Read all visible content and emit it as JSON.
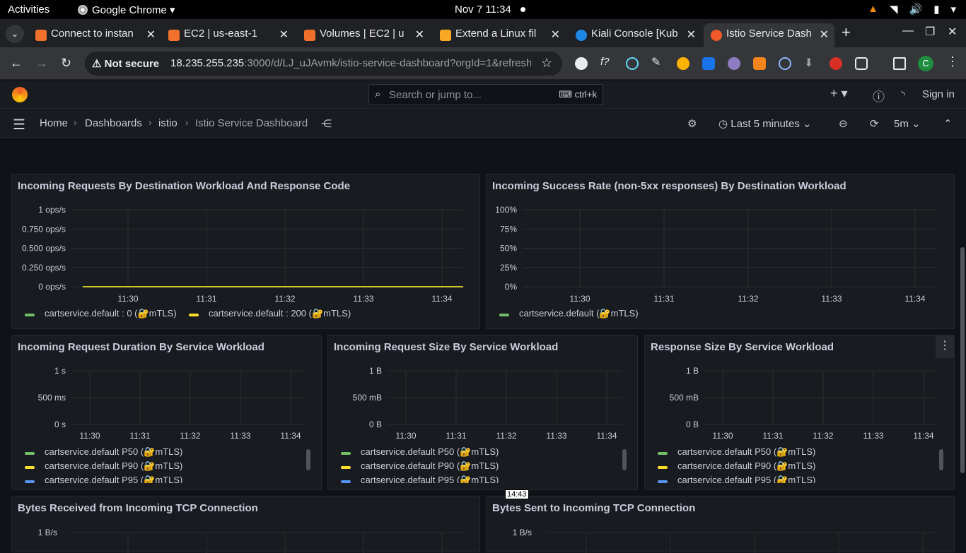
{
  "os": {
    "activities": "Activities",
    "app": "Google Chrome",
    "clock": "Nov 7  11:34"
  },
  "tabs": [
    {
      "title": "Connect to instan",
      "color": "#f0712c"
    },
    {
      "title": "EC2 | us-east-1",
      "color": "#f0712c"
    },
    {
      "title": "Volumes | EC2 | u",
      "color": "#f0712c"
    },
    {
      "title": "Extend a Linux fil",
      "color": "#f9a825"
    },
    {
      "title": "Kiali Console [Kub",
      "color": "#1e88e5"
    },
    {
      "title": "Istio Service Dash",
      "color": "#f05a28"
    }
  ],
  "toolbar": {
    "not_secure": "Not secure",
    "url_host": "18.235.255.235",
    "url_rest": ":3000/d/LJ_uJAvmk/istio-service-dashboard?orgId=1&refresh=5m",
    "profile": "C"
  },
  "grafana": {
    "search_placeholder": "Search or jump to...",
    "search_shortcut": "ctrl+k",
    "sign_in": "Sign in",
    "breadcrumbs": [
      "Home",
      "Dashboards",
      "istio",
      "Istio Service Dashboard"
    ],
    "time_range": "Last 5 minutes",
    "refresh": "5m"
  },
  "panels": {
    "p1": {
      "title": "Incoming Requests By Destination Workload And Response Code",
      "legend": [
        "cartservice.default : 0 (🔐mTLS)",
        "cartservice.default : 200 (🔐mTLS)"
      ]
    },
    "p2": {
      "title": "Incoming Success Rate (non-5xx responses) By Destination Workload",
      "legend": [
        "cartservice.default (🔐mTLS)"
      ]
    },
    "p3": {
      "title": "Incoming Request Duration By Service Workload",
      "legend": [
        "cartservice.default P50 (🔐mTLS)",
        "cartservice.default P90 (🔐mTLS)",
        "cartservice.default P95 (🔐mTLS)"
      ]
    },
    "p4": {
      "title": "Incoming Request Size By Service Workload",
      "legend": [
        "cartservice.default P50 (🔐mTLS)",
        "cartservice.default P90 (🔐mTLS)",
        "cartservice.default P95 (🔐mTLS)"
      ]
    },
    "p5": {
      "title": "Response Size By Service Workload",
      "legend": [
        "cartservice.default P50 (🔐mTLS)",
        "cartservice.default P90 (🔐mTLS)",
        "cartservice.default P95 (🔐mTLS)"
      ]
    },
    "p6": {
      "title": "Bytes Received from Incoming TCP Connection",
      "ytick": "1 B/s"
    },
    "p7": {
      "title": "Bytes Sent to Incoming TCP Connection",
      "ytick": "1 B/s"
    }
  },
  "colors": {
    "green": "#73bf69",
    "yellow": "#fade2a",
    "blue": "#5794f2"
  },
  "tooltip": "14:43",
  "chart_data": [
    {
      "type": "line",
      "title": "Incoming Requests By Destination Workload And Response Code",
      "x": [
        "11:30",
        "11:31",
        "11:32",
        "11:33",
        "11:34"
      ],
      "yticks": [
        "1 ops/s",
        "0.750 ops/s",
        "0.500 ops/s",
        "0.250 ops/s",
        "0 ops/s"
      ],
      "ylim": [
        0,
        1
      ],
      "series": [
        {
          "name": "cartservice.default : 0 (🔐mTLS)",
          "values": [
            0,
            0,
            0,
            0,
            0
          ]
        },
        {
          "name": "cartservice.default : 200 (🔐mTLS)",
          "values": [
            0,
            0,
            0,
            0,
            0
          ]
        }
      ]
    },
    {
      "type": "line",
      "title": "Incoming Success Rate (non-5xx responses) By Destination Workload",
      "x": [
        "11:30",
        "11:31",
        "11:32",
        "11:33",
        "11:34"
      ],
      "yticks": [
        "100%",
        "75%",
        "50%",
        "25%",
        "0%"
      ],
      "series": [
        {
          "name": "cartservice.default (🔐mTLS)",
          "values": []
        }
      ]
    },
    {
      "type": "line",
      "title": "Incoming Request Duration By Service Workload",
      "x": [
        "11:30",
        "11:31",
        "11:32",
        "11:33",
        "11:34"
      ],
      "yticks": [
        "1 s",
        "500 ms",
        "0 s"
      ]
    },
    {
      "type": "line",
      "title": "Incoming Request Size By Service Workload",
      "x": [
        "11:30",
        "11:31",
        "11:32",
        "11:33",
        "11:34"
      ],
      "yticks": [
        "1 B",
        "500 mB",
        "0 B"
      ]
    },
    {
      "type": "line",
      "title": "Response Size By Service Workload",
      "x": [
        "11:30",
        "11:31",
        "11:32",
        "11:33",
        "11:34"
      ],
      "yticks": [
        "1 B",
        "500 mB",
        "0 B"
      ]
    }
  ]
}
